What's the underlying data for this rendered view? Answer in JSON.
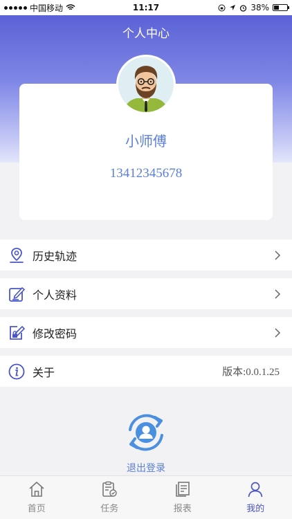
{
  "status_bar": {
    "carrier": "中国移动",
    "time": "11:17",
    "battery": "38%",
    "battery_level": 0.38
  },
  "header": {
    "title": "个人中心"
  },
  "profile": {
    "name": "小师傅",
    "phone": "13412345678"
  },
  "menu": [
    {
      "label": "历史轨迹",
      "icon": "location-pin-icon"
    },
    {
      "label": "个人资料",
      "icon": "edit-note-icon"
    },
    {
      "label": "修改密码",
      "icon": "edit-lock-icon"
    },
    {
      "label": "关于",
      "icon": "info-icon",
      "value": "版本:0.0.1.25"
    }
  ],
  "logout": {
    "label": "退出登录",
    "icon": "refresh-user-icon"
  },
  "tabs": [
    {
      "label": "首页",
      "icon": "home-icon",
      "active": false
    },
    {
      "label": "任务",
      "icon": "clipboard-check-icon",
      "active": false
    },
    {
      "label": "报表",
      "icon": "report-icon",
      "active": false
    },
    {
      "label": "我的",
      "icon": "user-icon",
      "active": true
    }
  ],
  "colors": {
    "accent": "#4b55c8",
    "text_blue": "#5b7fd8",
    "header": "#5b62d6"
  }
}
